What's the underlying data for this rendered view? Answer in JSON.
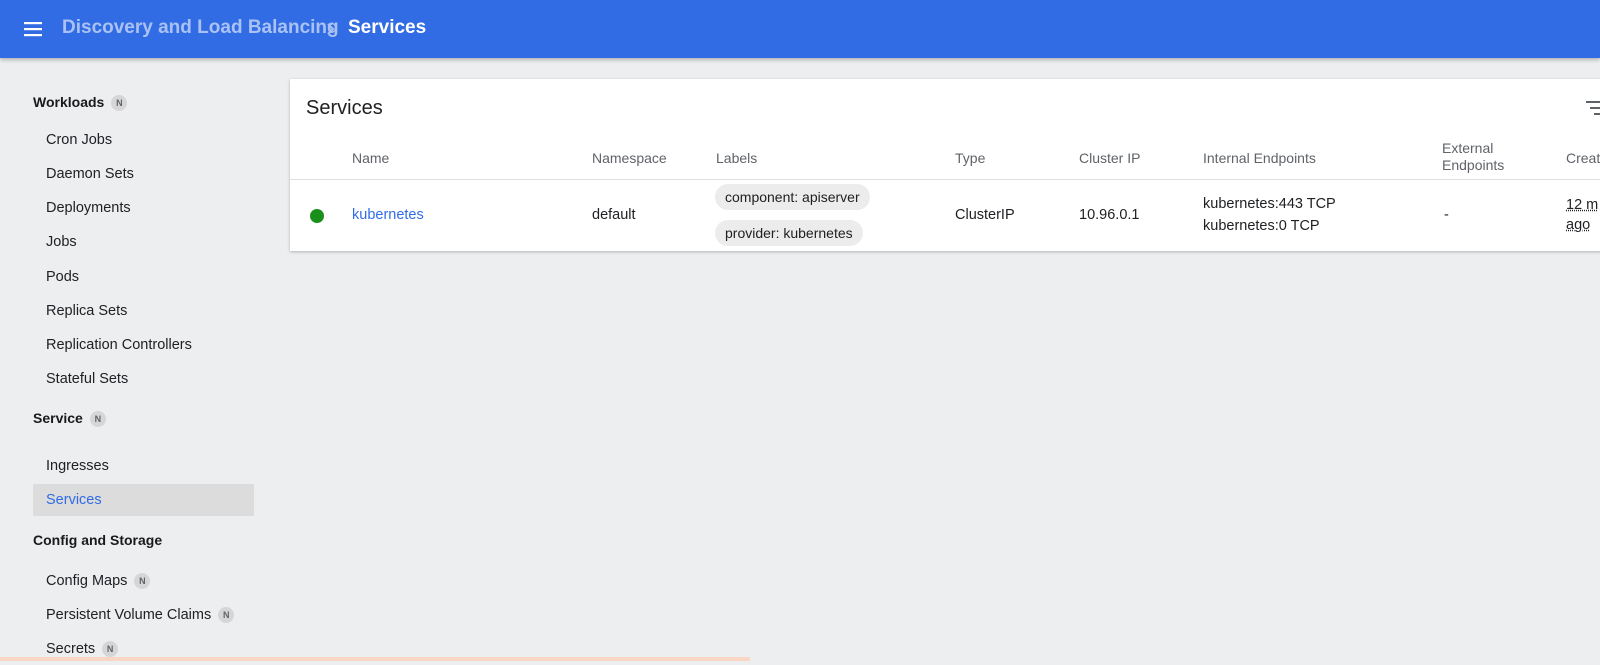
{
  "header": {
    "parent": "Discovery and Load Balancing",
    "current": "Services"
  },
  "sidebar": {
    "workloads": {
      "label": "Workloads",
      "badge": "N",
      "items": [
        "Cron Jobs",
        "Daemon Sets",
        "Deployments",
        "Jobs",
        "Pods",
        "Replica Sets",
        "Replication Controllers",
        "Stateful Sets"
      ]
    },
    "service": {
      "label": "Service",
      "badge": "N",
      "items": [
        "Ingresses",
        "Services"
      ],
      "selected": "Services"
    },
    "config": {
      "label": "Config and Storage",
      "items": [
        {
          "label": "Config Maps",
          "badge": "N"
        },
        {
          "label": "Persistent Volume Claims",
          "badge": "N"
        },
        {
          "label": "Secrets",
          "badge": "N"
        }
      ]
    }
  },
  "card": {
    "title": "Services",
    "columns": {
      "name": "Name",
      "namespace": "Namespace",
      "labels": "Labels",
      "type": "Type",
      "cluster_ip": "Cluster IP",
      "internal_endpoints": "Internal Endpoints",
      "external_endpoints_1": "External",
      "external_endpoints_2": "Endpoints",
      "created": "Creat"
    },
    "rows": [
      {
        "status": "running",
        "name": "kubernetes",
        "namespace": "default",
        "labels": [
          "component: apiserver",
          "provider: kubernetes"
        ],
        "type": "ClusterIP",
        "cluster_ip": "10.96.0.1",
        "internal_endpoints": [
          "kubernetes:443 TCP",
          "kubernetes:0 TCP"
        ],
        "external_endpoints": "-",
        "created_1": "12 m",
        "created_2": "ago"
      }
    ]
  },
  "colors": {
    "topbar": "#326ce5",
    "status_running": "#1a8f1a"
  },
  "icons": {
    "menu": "menu-icon",
    "separator": "chevron-right-icon",
    "filter": "filter-icon"
  }
}
